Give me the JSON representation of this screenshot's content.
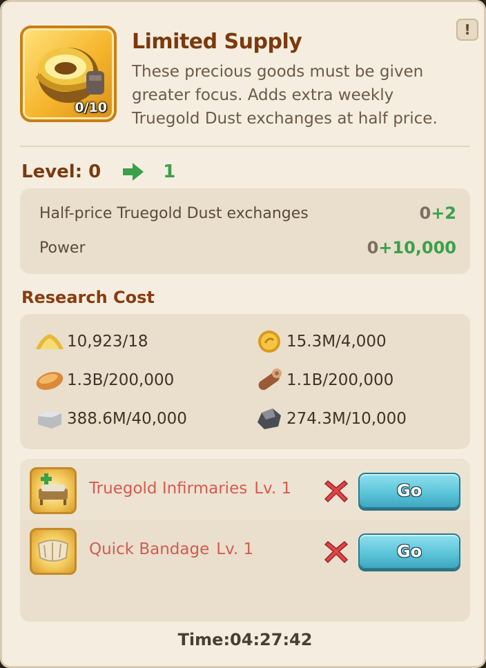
{
  "item": {
    "title": "Limited Supply",
    "description": "These precious goods must be given greater focus. Adds extra weekly Truegold Dust exchanges at half price.",
    "count": "0/10",
    "alert_icon": "exclamation-icon",
    "alert_symbol": "!"
  },
  "level": {
    "label": "Level: 0",
    "next": "1",
    "arrow_color": "#3aa04a"
  },
  "stats": [
    {
      "label": "Half-price Truegold Dust exchanges",
      "base": "0",
      "add": "+2"
    },
    {
      "label": "Power",
      "base": "0",
      "add": "+10,000"
    }
  ],
  "research_cost": {
    "title": "Research Cost",
    "items": [
      {
        "icon": "truegold-dust-icon",
        "value": "10,923/18"
      },
      {
        "icon": "coin-icon",
        "value": "15.3M/4,000"
      },
      {
        "icon": "bread-icon",
        "value": "1.3B/200,000"
      },
      {
        "icon": "wood-log-icon",
        "value": "1.1B/200,000"
      },
      {
        "icon": "stone-icon",
        "value": "388.6M/40,000"
      },
      {
        "icon": "iron-ore-icon",
        "value": "274.3M/10,000"
      }
    ]
  },
  "requirements": [
    {
      "icon": "infirmary-bed-icon",
      "name": "Truegold Infirmaries",
      "level": "Lv. 1",
      "status_icon": "red-x-icon",
      "button": "Go"
    },
    {
      "icon": "bandage-icon",
      "name": "Quick Bandage",
      "level": "Lv. 1",
      "status_icon": "red-x-icon",
      "button": "Go"
    }
  ],
  "timer": "Time:04:27:42"
}
